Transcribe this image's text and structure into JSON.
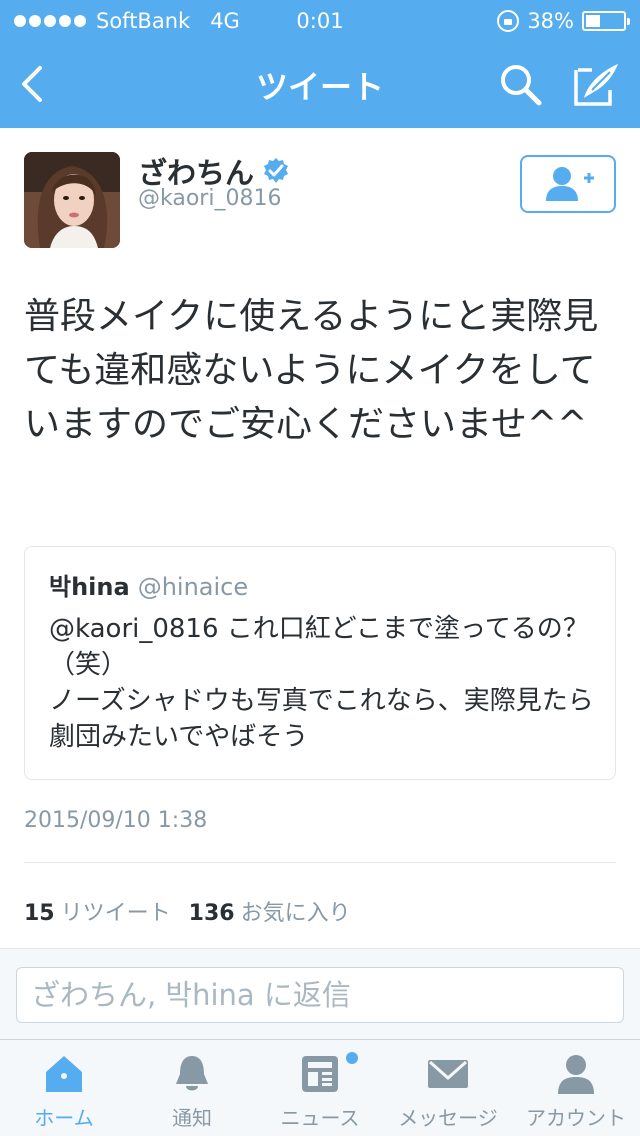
{
  "status_bar": {
    "carrier": "SoftBank",
    "network": "4G",
    "time": "0:01",
    "battery_text": "38%",
    "battery_level": 0.38
  },
  "navbar": {
    "title": "ツイート",
    "back_icon": "chevron-left-icon",
    "search_icon": "search-icon",
    "compose_icon": "compose-icon"
  },
  "tweet": {
    "display_name": "ざわちん",
    "verified": true,
    "handle": "@kaori_0816",
    "text": "普段メイクに使えるようにと実際見ても違和感ないようにメイクをしていますのでご安心くださいませ^^",
    "timestamp": "2015/09/10 1:38",
    "retweet_count": "15",
    "retweet_label": "リツイート",
    "favorite_count": "136",
    "favorite_label": "お気に入り"
  },
  "quote": {
    "name": "박hina",
    "handle": "@hinaice",
    "text": "@kaori_0816 これ口紅どこまで塗ってるの？（笑）\nノーズシャドウも写真でこれなら、実際見たら劇団みたいでやばそう"
  },
  "reply": {
    "placeholder": "ざわちん, 박hina に返信"
  },
  "tabs": [
    {
      "label": "ホーム",
      "icon": "home-icon",
      "active": true
    },
    {
      "label": "通知",
      "icon": "bell-icon",
      "active": false
    },
    {
      "label": "ニュース",
      "icon": "news-icon",
      "active": false
    },
    {
      "label": "メッセージ",
      "icon": "mail-icon",
      "active": false
    },
    {
      "label": "アカウント",
      "icon": "person-icon",
      "active": false
    }
  ],
  "colors": {
    "accent": "#55acee",
    "text": "#292f33",
    "muted": "#8899a6"
  }
}
